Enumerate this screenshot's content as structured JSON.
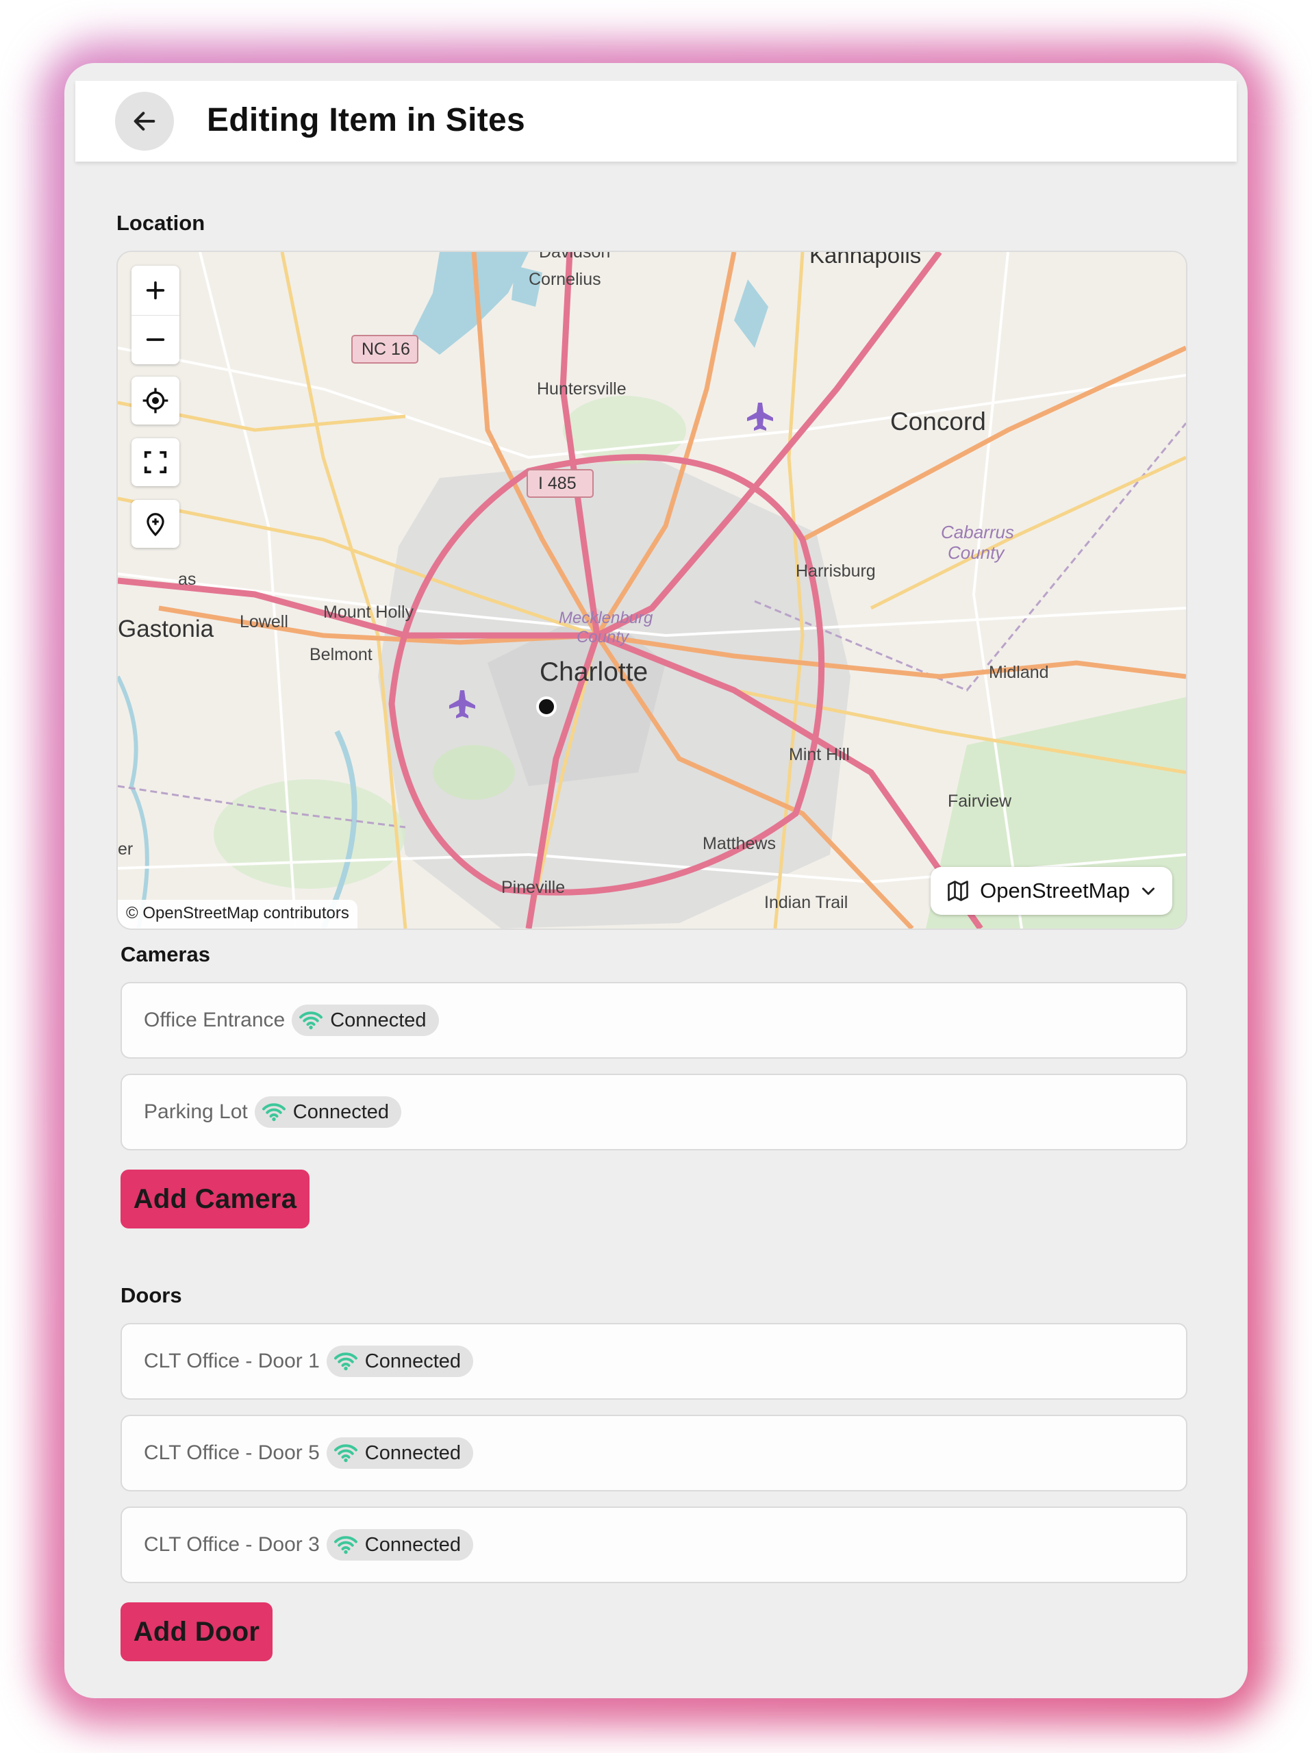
{
  "header": {
    "title": "Editing Item in Sites"
  },
  "location": {
    "label": "Location",
    "map": {
      "attribution": "© OpenStreetMap contributors",
      "layer_label": "OpenStreetMap",
      "places": {
        "davidson": "Davidson",
        "cornelius": "Cornelius",
        "kannapolis": "Kannapolis",
        "huntersville": "Huntersville",
        "concord": "Concord",
        "nc16": "NC 16",
        "i485": "I 485",
        "cabarrus1": "Cabarrus",
        "cabarrus2": "County",
        "harrisburg": "Harrisburg",
        "mount_holly": "Mount Holly",
        "as": "as",
        "gastonia": "Gastonia",
        "lowell": "Lowell",
        "belmont": "Belmont",
        "mecklenburg1": "Mecklenburg",
        "mecklenburg2": "County",
        "charlotte": "Charlotte",
        "midland": "Midland",
        "mint_hill": "Mint Hill",
        "fairview": "Fairview",
        "matthews": "Matthews",
        "er": "er",
        "pineville": "Pineville",
        "indian_trail": "Indian Trail"
      }
    }
  },
  "cameras": {
    "label": "Cameras",
    "items": [
      {
        "name": "Office Entrance",
        "status": "Connected"
      },
      {
        "name": "Parking Lot",
        "status": "Connected"
      }
    ],
    "add_label": "Add Camera"
  },
  "doors": {
    "label": "Doors",
    "items": [
      {
        "name": "CLT Office - Door 1",
        "status": "Connected"
      },
      {
        "name": "CLT Office - Door 5",
        "status": "Connected"
      },
      {
        "name": "CLT Office - Door 3",
        "status": "Connected"
      }
    ],
    "add_label": "Add Door"
  },
  "colors": {
    "accent": "#e2356a",
    "status_green": "#3cc79a",
    "frame_glow": "#e0628f"
  }
}
